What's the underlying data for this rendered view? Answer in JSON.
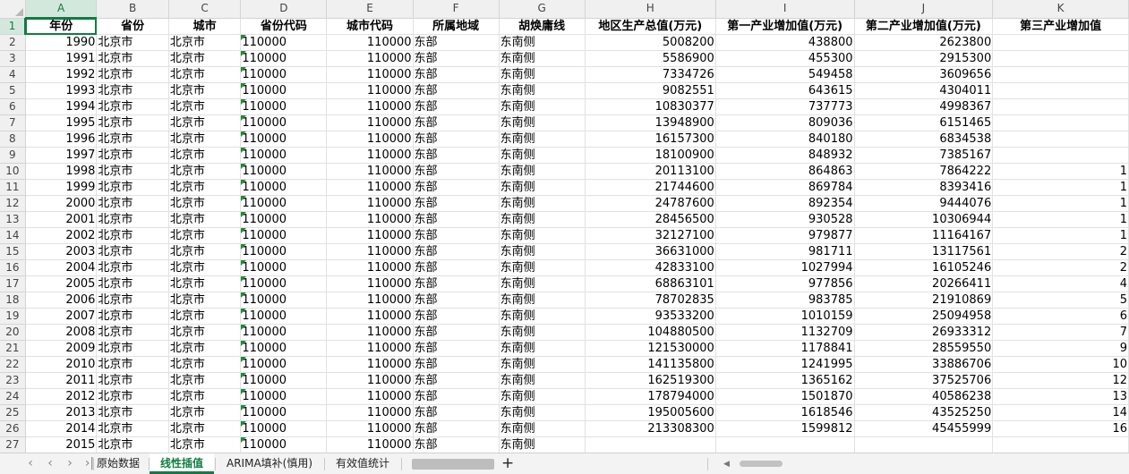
{
  "columns": [
    "A",
    "B",
    "C",
    "D",
    "E",
    "F",
    "G",
    "H",
    "I",
    "J",
    "K"
  ],
  "header_row": [
    "年份",
    "省份",
    "城市",
    "省份代码",
    "城市代码",
    "所属地域",
    "胡焕庸线",
    "地区生产总值(万元)",
    "第一产业增加值(万元)",
    "第二产业增加值(万元)",
    "第三产业增加值"
  ],
  "rows": [
    {
      "n": "2",
      "c": [
        "1990",
        "北京市",
        "北京市",
        "110000",
        "110000",
        "东部",
        "东南侧",
        "5008200",
        "438800",
        "2623800",
        ""
      ]
    },
    {
      "n": "3",
      "c": [
        "1991",
        "北京市",
        "北京市",
        "110000",
        "110000",
        "东部",
        "东南侧",
        "5586900",
        "455300",
        "2915300",
        ""
      ]
    },
    {
      "n": "4",
      "c": [
        "1992",
        "北京市",
        "北京市",
        "110000",
        "110000",
        "东部",
        "东南侧",
        "7334726",
        "549458",
        "3609656",
        ""
      ]
    },
    {
      "n": "5",
      "c": [
        "1993",
        "北京市",
        "北京市",
        "110000",
        "110000",
        "东部",
        "东南侧",
        "9082551",
        "643615",
        "4304011",
        ""
      ]
    },
    {
      "n": "6",
      "c": [
        "1994",
        "北京市",
        "北京市",
        "110000",
        "110000",
        "东部",
        "东南侧",
        "10830377",
        "737773",
        "4998367",
        ""
      ]
    },
    {
      "n": "7",
      "c": [
        "1995",
        "北京市",
        "北京市",
        "110000",
        "110000",
        "东部",
        "东南侧",
        "13948900",
        "809036",
        "6151465",
        ""
      ]
    },
    {
      "n": "8",
      "c": [
        "1996",
        "北京市",
        "北京市",
        "110000",
        "110000",
        "东部",
        "东南侧",
        "16157300",
        "840180",
        "6834538",
        ""
      ]
    },
    {
      "n": "9",
      "c": [
        "1997",
        "北京市",
        "北京市",
        "110000",
        "110000",
        "东部",
        "东南侧",
        "18100900",
        "848932",
        "7385167",
        ""
      ]
    },
    {
      "n": "10",
      "c": [
        "1998",
        "北京市",
        "北京市",
        "110000",
        "110000",
        "东部",
        "东南侧",
        "20113100",
        "864863",
        "7864222",
        "1"
      ]
    },
    {
      "n": "11",
      "c": [
        "1999",
        "北京市",
        "北京市",
        "110000",
        "110000",
        "东部",
        "东南侧",
        "21744600",
        "869784",
        "8393416",
        "1"
      ]
    },
    {
      "n": "12",
      "c": [
        "2000",
        "北京市",
        "北京市",
        "110000",
        "110000",
        "东部",
        "东南侧",
        "24787600",
        "892354",
        "9444076",
        "1"
      ]
    },
    {
      "n": "13",
      "c": [
        "2001",
        "北京市",
        "北京市",
        "110000",
        "110000",
        "东部",
        "东南侧",
        "28456500",
        "930528",
        "10306944",
        "1"
      ]
    },
    {
      "n": "14",
      "c": [
        "2002",
        "北京市",
        "北京市",
        "110000",
        "110000",
        "东部",
        "东南侧",
        "32127100",
        "979877",
        "11164167",
        "1"
      ]
    },
    {
      "n": "15",
      "c": [
        "2003",
        "北京市",
        "北京市",
        "110000",
        "110000",
        "东部",
        "东南侧",
        "36631000",
        "981711",
        "13117561",
        "2"
      ]
    },
    {
      "n": "16",
      "c": [
        "2004",
        "北京市",
        "北京市",
        "110000",
        "110000",
        "东部",
        "东南侧",
        "42833100",
        "1027994",
        "16105246",
        "2"
      ]
    },
    {
      "n": "17",
      "c": [
        "2005",
        "北京市",
        "北京市",
        "110000",
        "110000",
        "东部",
        "东南侧",
        "68863101",
        "977856",
        "20266411",
        "4"
      ]
    },
    {
      "n": "18",
      "c": [
        "2006",
        "北京市",
        "北京市",
        "110000",
        "110000",
        "东部",
        "东南侧",
        "78702835",
        "983785",
        "21910869",
        "5"
      ]
    },
    {
      "n": "19",
      "c": [
        "2007",
        "北京市",
        "北京市",
        "110000",
        "110000",
        "东部",
        "东南侧",
        "93533200",
        "1010159",
        "25094958",
        "6"
      ]
    },
    {
      "n": "20",
      "c": [
        "2008",
        "北京市",
        "北京市",
        "110000",
        "110000",
        "东部",
        "东南侧",
        "104880500",
        "1132709",
        "26933312",
        "7"
      ]
    },
    {
      "n": "21",
      "c": [
        "2009",
        "北京市",
        "北京市",
        "110000",
        "110000",
        "东部",
        "东南侧",
        "121530000",
        "1178841",
        "28559550",
        "9"
      ]
    },
    {
      "n": "22",
      "c": [
        "2010",
        "北京市",
        "北京市",
        "110000",
        "110000",
        "东部",
        "东南侧",
        "141135800",
        "1241995",
        "33886706",
        "10"
      ]
    },
    {
      "n": "23",
      "c": [
        "2011",
        "北京市",
        "北京市",
        "110000",
        "110000",
        "东部",
        "东南侧",
        "162519300",
        "1365162",
        "37525706",
        "12"
      ]
    },
    {
      "n": "24",
      "c": [
        "2012",
        "北京市",
        "北京市",
        "110000",
        "110000",
        "东部",
        "东南侧",
        "178794000",
        "1501870",
        "40586238",
        "13"
      ]
    },
    {
      "n": "25",
      "c": [
        "2013",
        "北京市",
        "北京市",
        "110000",
        "110000",
        "东部",
        "东南侧",
        "195005600",
        "1618546",
        "43525250",
        "14"
      ]
    },
    {
      "n": "26",
      "c": [
        "2014",
        "北京市",
        "北京市",
        "110000",
        "110000",
        "东部",
        "东南侧",
        "213308300",
        "1599812",
        "45455999",
        "16"
      ]
    },
    {
      "n": "27",
      "c": [
        "2015",
        "北京市",
        "北京市",
        "110000",
        "110000",
        "东部",
        "东南侧",
        "",
        "",
        "",
        ""
      ]
    }
  ],
  "tabs": [
    "原始数据",
    "线性插值",
    "ARIMA填补(慎用)",
    "有效值统计"
  ],
  "active_tab": 1,
  "accent_color": "#107c41",
  "icons": {
    "nav_first": "|<",
    "nav_prev": "<",
    "nav_next": ">",
    "nav_last": ">|",
    "add": "+"
  }
}
